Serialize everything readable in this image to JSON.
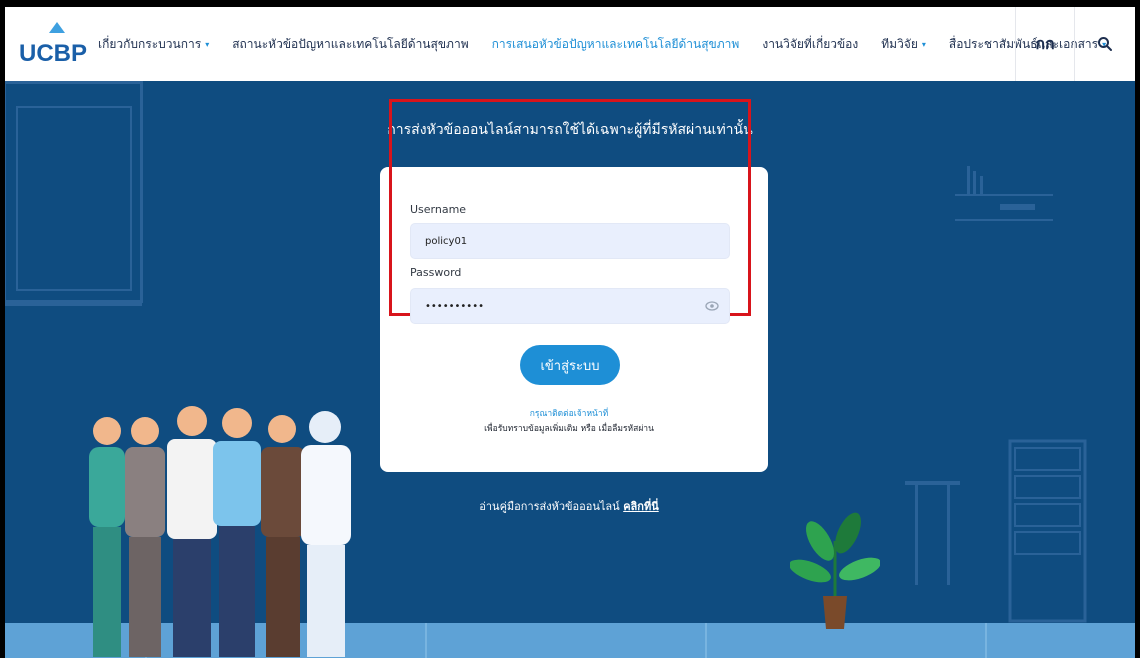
{
  "brand": {
    "logo_text": "UCBP",
    "colors": {
      "navy": "#0f4c80",
      "accent": "#1e8fd6",
      "highlight": "#d8141b",
      "floor": "#5ea2d6"
    }
  },
  "nav": {
    "items": [
      {
        "label": "เกี่ยวกับกระบวนการ",
        "dropdown": true,
        "active": false
      },
      {
        "label": "สถานะหัวข้อปัญหาและเทคโนโลยีด้านสุขภาพ",
        "dropdown": false,
        "active": false
      },
      {
        "label": "การเสนอหัวข้อปัญหาและเทคโนโลยีด้านสุขภาพ",
        "dropdown": false,
        "active": true
      },
      {
        "label": "งานวิจัยที่เกี่ยวข้อง",
        "dropdown": false,
        "active": false
      },
      {
        "label": "ทีมวิจัย",
        "dropdown": true,
        "active": false
      },
      {
        "label": "สื่อประชาสัมพันธ์และเอกสาร",
        "dropdown": true,
        "active": false
      }
    ],
    "dropdown_glyph": "▾",
    "language_label": "กก",
    "search_icon": "search-icon"
  },
  "login": {
    "title": "การส่งหัวข้อออนไลน์สามารถใช้ได้เฉพาะผู้ที่มีรหัสผ่านเท่านั้น",
    "username_label": "Username",
    "username_value": "policy01",
    "password_label": "Password",
    "password_value": "••••••••••",
    "show_password_icon": "eye-icon",
    "submit_label": "เข้าสู่ระบบ",
    "contact_link": "กรุณาติดต่อเจ้าหน้าที่",
    "contact_note": "เพื่อรับทราบข้อมูลเพิ่มเติม หรือ เมื่อลืมรหัสผ่าน",
    "manual_text": "อ่านคู่มือการส่งหัวข้อออนไลน์",
    "manual_link": "คลิกที่นี่"
  }
}
